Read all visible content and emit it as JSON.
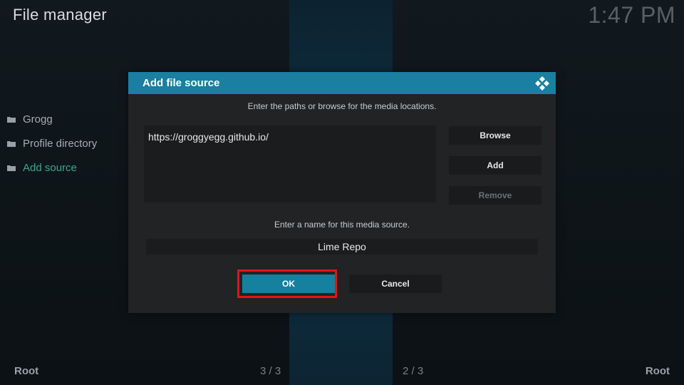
{
  "window": {
    "title": "File manager",
    "clock": "1:47 PM"
  },
  "sidebar": {
    "items": [
      {
        "label": "Grogg",
        "icon": "folder-icon",
        "active": false
      },
      {
        "label": "Profile directory",
        "icon": "folder-icon",
        "active": false
      },
      {
        "label": "Add source",
        "icon": "folder-icon",
        "active": true
      }
    ]
  },
  "footer": {
    "left_label": "Root",
    "left_count": "3 / 3",
    "right_count": "2 / 3",
    "right_label": "Root"
  },
  "dialog": {
    "title": "Add file source",
    "logo_icon": "kodi-logo-icon",
    "paths_instruction": "Enter the paths or browse for the media locations.",
    "paths": [
      "https://groggyegg.github.io/"
    ],
    "browse_label": "Browse",
    "add_label": "Add",
    "remove_label": "Remove",
    "name_instruction": "Enter a name for this media source.",
    "name_value": "Lime Repo",
    "ok_label": "OK",
    "cancel_label": "Cancel"
  },
  "colors": {
    "accent": "#1a7fa1",
    "active_item": "#3aa88c",
    "highlight_border": "#e1141c"
  }
}
